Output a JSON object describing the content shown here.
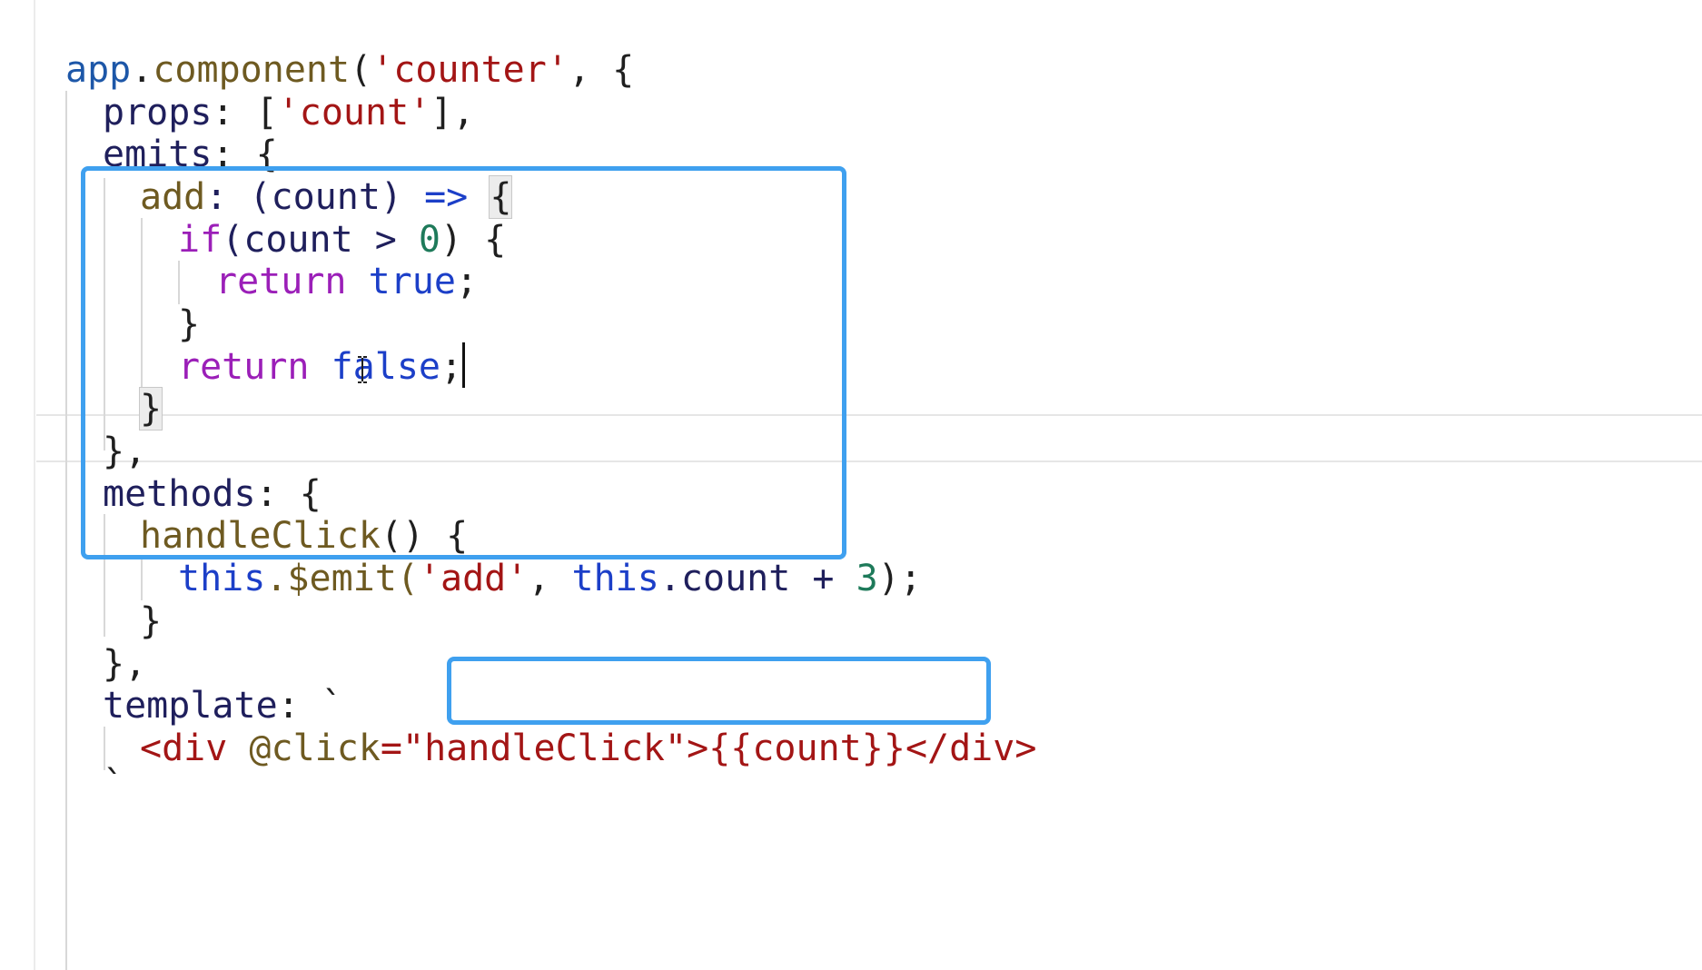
{
  "editor": {
    "lines": {
      "l1": {
        "obj": "app",
        "dot": ".",
        "method": "component",
        "paren": "(",
        "name": "'counter'",
        "rest": ", {"
      },
      "l2": {
        "key": "props",
        "colon": ": [",
        "val": "'count'",
        "rest": "],"
      },
      "l3": {
        "key": "emits",
        "rest": ": {"
      },
      "l4": {
        "key": "add",
        "mid": ": (count) ",
        "arrow": "=>",
        "sp": " ",
        "brace": "{"
      },
      "l5": {
        "kw": "if",
        "mid": "(count > ",
        "num": "0",
        "rest": ") {"
      },
      "l6": {
        "kw": "return",
        "sp": " ",
        "lit": "true",
        "rest": ";"
      },
      "l7": {
        "text": "}"
      },
      "l8": {
        "kw": "return",
        "sp": " ",
        "lit": "false",
        "rest": ";"
      },
      "l9": {
        "text": "}"
      },
      "l10": {
        "text": "},"
      },
      "l11": {
        "key": "methods",
        "rest": ": {"
      },
      "l12": {
        "fn": "handleClick",
        "rest": "() {"
      },
      "l13": {
        "this1": "this",
        "emit": ".$emit(",
        "str": "'add'",
        "comma": ", ",
        "this2": "this",
        "rest": ".count + ",
        "num": "3",
        "end": ");"
      },
      "l14": {
        "text": "}"
      },
      "l15": {
        "text": "},"
      },
      "l16": {
        "key": "template",
        "rest": ": `"
      },
      "l17": {
        "open": "<div ",
        "attr": "@click",
        "eq": "=",
        "val": "\"handleClick\"",
        "gt": ">",
        "mustache": "{{count}}",
        "close": "</div>"
      },
      "l18": {
        "text": "`"
      }
    }
  },
  "colors": {
    "highlight_border": "#3fa0ef",
    "string": "#a31515",
    "keyword": "#9b1fb8",
    "literal": "#1c3fc8",
    "number": "#1e7a5a"
  },
  "icons": {
    "text_cursor": "i-beam-cursor-icon"
  }
}
